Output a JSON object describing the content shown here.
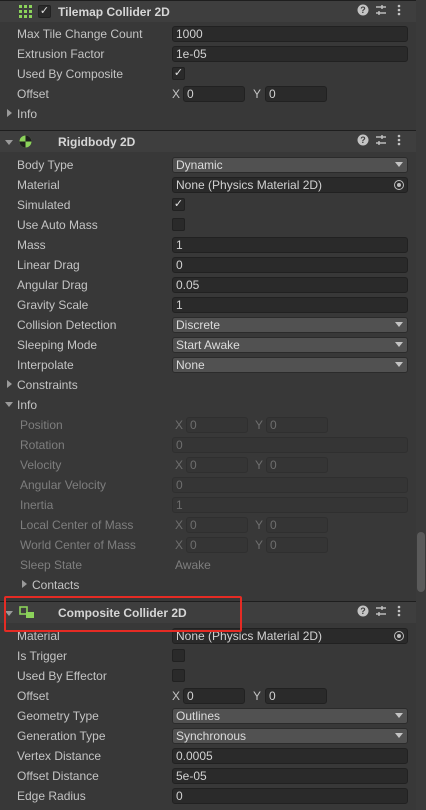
{
  "tilemap_collider": {
    "title": "Tilemap Collider 2D",
    "enabled_check": "✓",
    "icons": [
      "help-icon",
      "presets-icon",
      "more-icon"
    ],
    "rows": [
      {
        "label": "Max Tile Change Count",
        "value": "1000"
      },
      {
        "label": "Extrusion Factor",
        "value": "1e-05"
      },
      {
        "label": "Used By Composite",
        "check": "✓"
      }
    ],
    "offset": {
      "label": "Offset",
      "x_axis": "X",
      "x": "0",
      "y_axis": "Y",
      "y": "0"
    },
    "info_label": "Info"
  },
  "rigidbody": {
    "title": "Rigidbody 2D",
    "body_type": {
      "label": "Body Type",
      "value": "Dynamic"
    },
    "material": {
      "label": "Material",
      "value": "None (Physics Material 2D)"
    },
    "simulated": {
      "label": "Simulated",
      "check": "✓"
    },
    "use_auto_mass": {
      "label": "Use Auto Mass",
      "check": ""
    },
    "mass": {
      "label": "Mass",
      "value": "1"
    },
    "linear_drag": {
      "label": "Linear Drag",
      "value": "0"
    },
    "angular_drag": {
      "label": "Angular Drag",
      "value": "0.05"
    },
    "gravity_scale": {
      "label": "Gravity Scale",
      "value": "1"
    },
    "collision_detection": {
      "label": "Collision Detection",
      "value": "Discrete"
    },
    "sleeping_mode": {
      "label": "Sleeping Mode",
      "value": "Start Awake"
    },
    "interpolate": {
      "label": "Interpolate",
      "value": "None"
    },
    "constraints_label": "Constraints",
    "info_label": "Info",
    "info": {
      "position": {
        "label": "Position",
        "x_axis": "X",
        "x": "0",
        "y_axis": "Y",
        "y": "0"
      },
      "rotation": {
        "label": "Rotation",
        "value": "0"
      },
      "velocity": {
        "label": "Velocity",
        "x_axis": "X",
        "x": "0",
        "y_axis": "Y",
        "y": "0"
      },
      "angular_velocity": {
        "label": "Angular Velocity",
        "value": "0"
      },
      "inertia": {
        "label": "Inertia",
        "value": "1"
      },
      "local_center": {
        "label": "Local Center of Mass",
        "x_axis": "X",
        "x": "0",
        "y_axis": "Y",
        "y": "0"
      },
      "world_center": {
        "label": "World Center of Mass",
        "x_axis": "X",
        "x": "0",
        "y_axis": "Y",
        "y": "0"
      },
      "sleep_state": {
        "label": "Sleep State",
        "value": "Awake"
      },
      "contacts_label": "Contacts"
    }
  },
  "composite": {
    "title": "Composite Collider 2D",
    "material": {
      "label": "Material",
      "value": "None (Physics Material 2D)"
    },
    "is_trigger": {
      "label": "Is Trigger",
      "check": ""
    },
    "used_by_effector": {
      "label": "Used By Effector",
      "check": ""
    },
    "offset": {
      "label": "Offset",
      "x_axis": "X",
      "x": "0",
      "y_axis": "Y",
      "y": "0"
    },
    "geometry_type": {
      "label": "Geometry Type",
      "value": "Outlines"
    },
    "generation_type": {
      "label": "Generation Type",
      "value": "Synchronous"
    },
    "vertex_distance": {
      "label": "Vertex Distance",
      "value": "0.0005"
    },
    "offset_distance": {
      "label": "Offset Distance",
      "value": "5e-05"
    },
    "edge_radius": {
      "label": "Edge Radius",
      "value": "0"
    }
  },
  "colors": {
    "highlight": "#e52b24",
    "panel": "#383838"
  }
}
